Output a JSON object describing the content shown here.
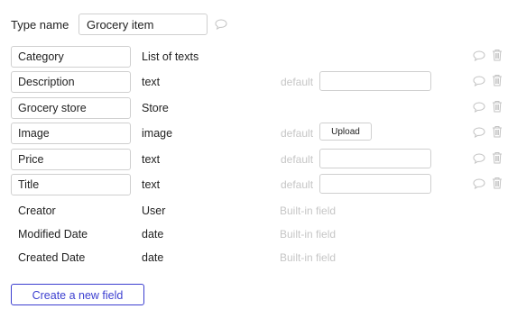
{
  "type_name": {
    "label": "Type name",
    "value": "Grocery item"
  },
  "fields": [
    {
      "name": "Category",
      "type": "List of texts",
      "default_label": "",
      "default_control": "none"
    },
    {
      "name": "Description",
      "type": "text",
      "default_label": "default",
      "default_control": "input"
    },
    {
      "name": "Grocery store",
      "type": "Store",
      "default_label": "",
      "default_control": "none"
    },
    {
      "name": "Image",
      "type": "image",
      "default_label": "default",
      "default_control": "upload",
      "upload_label": "Upload"
    },
    {
      "name": "Price",
      "type": "text",
      "default_label": "default",
      "default_control": "input"
    },
    {
      "name": "Title",
      "type": "text",
      "default_label": "default",
      "default_control": "input"
    }
  ],
  "builtin_fields": [
    {
      "name": "Creator",
      "type": "User",
      "note": "Built-in field"
    },
    {
      "name": "Modified Date",
      "type": "date",
      "note": "Built-in field"
    },
    {
      "name": "Created Date",
      "type": "date",
      "note": "Built-in field"
    }
  ],
  "create_button_label": "Create a new field",
  "icons": {
    "comment": "speech-bubble-icon",
    "delete": "trash-icon"
  },
  "colors": {
    "accent": "#3c3fd0",
    "muted_text": "#c6c6c6",
    "border": "#cfcfcf",
    "icon": "#c2c2c2"
  }
}
